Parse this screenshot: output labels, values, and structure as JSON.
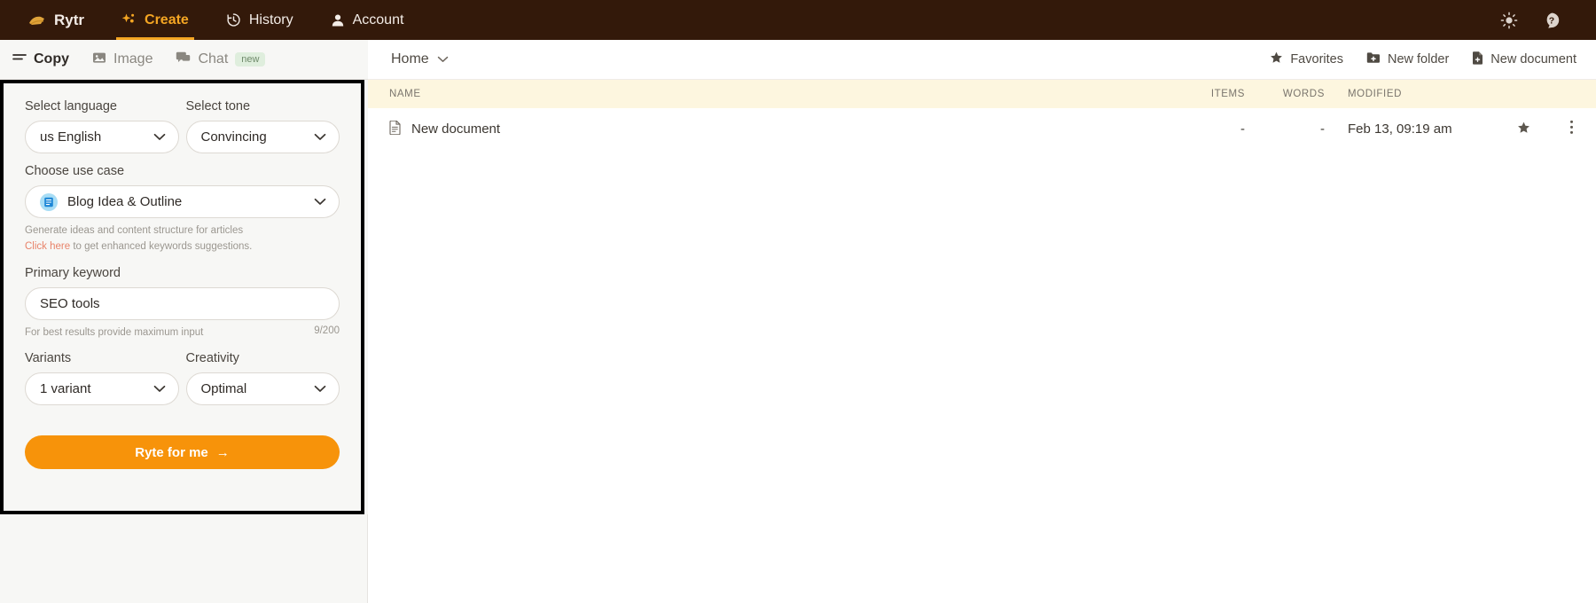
{
  "topnav": {
    "items": [
      {
        "label": "Rytr",
        "icon": "rytr-logo-icon",
        "active": false
      },
      {
        "label": "Create",
        "icon": "sparkle-icon",
        "active": true
      },
      {
        "label": "History",
        "icon": "clock-icon",
        "active": false
      },
      {
        "label": "Account",
        "icon": "person-icon",
        "active": false
      }
    ],
    "right_icons": [
      "brightness-icon",
      "help-icon"
    ]
  },
  "subtabs": {
    "items": [
      {
        "label": "Copy",
        "icon": "lines-icon",
        "active": true,
        "badge": ""
      },
      {
        "label": "Image",
        "icon": "image-icon",
        "active": false,
        "badge": ""
      },
      {
        "label": "Chat",
        "icon": "chat-icon",
        "active": false,
        "badge": "new"
      }
    ]
  },
  "form": {
    "language": {
      "label": "Select language",
      "value": "us English"
    },
    "tone": {
      "label": "Select tone",
      "value": "Convincing"
    },
    "use_case": {
      "label": "Choose use case",
      "value": "Blog Idea & Outline",
      "description": "Generate ideas and content structure for articles",
      "link_text": "Click here",
      "link_suffix": " to get enhanced keywords suggestions."
    },
    "primary_keyword": {
      "label": "Primary keyword",
      "value": "SEO tools",
      "placeholder": "Primary keyword",
      "helper": "For best results provide maximum input",
      "counter": "9/200"
    },
    "variants": {
      "label": "Variants",
      "value": "1 variant"
    },
    "creativity": {
      "label": "Creativity",
      "value": "Optimal"
    },
    "submit": {
      "label": "Ryte for me",
      "arrow": "→"
    }
  },
  "workspace": {
    "breadcrumb": "Home",
    "actions": [
      {
        "label": "Favorites",
        "icon": "star-icon"
      },
      {
        "label": "New folder",
        "icon": "folder-plus-icon"
      },
      {
        "label": "New document",
        "icon": "file-plus-icon"
      }
    ],
    "table": {
      "columns": [
        "NAME",
        "ITEMS",
        "WORDS",
        "MODIFIED"
      ],
      "rows": [
        {
          "name": "New document",
          "icon": "document-icon",
          "items": "-",
          "words": "-",
          "modified": "Feb 13, 09:19 am"
        }
      ]
    }
  },
  "colors": {
    "topbar": "#33190a",
    "accent": "#f5a623",
    "cta": "#f7930a",
    "table_header": "#fdf6df",
    "link": "#e8836a"
  }
}
